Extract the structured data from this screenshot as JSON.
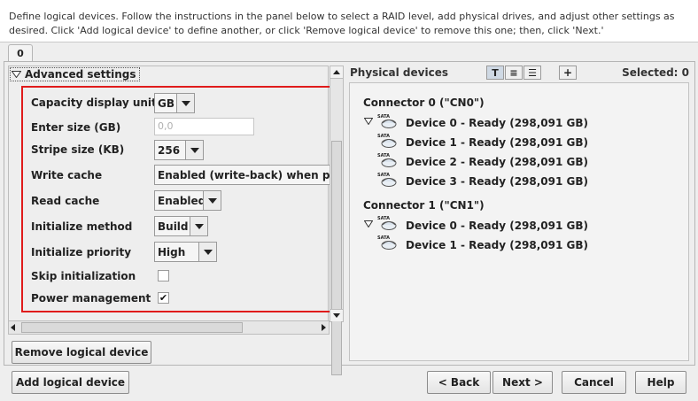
{
  "instructions": "Define logical devices.  Follow the instructions in the panel below to select a RAID level, add physical drives, and adjust other settings as desired.  Click 'Add logical device' to define another, or click 'Remove logical device' to remove this one; then, click 'Next.'",
  "tab": {
    "label": "0"
  },
  "advanced": {
    "header": "Advanced settings",
    "capacity_units": {
      "label": "Capacity display units",
      "value": "GB"
    },
    "enter_size": {
      "label": "Enter size (GB)",
      "placeholder": "0,0"
    },
    "stripe_size": {
      "label": "Stripe size (KB)",
      "value": "256"
    },
    "write_cache": {
      "label": "Write cache",
      "value": "Enabled (write-back) when protect"
    },
    "read_cache": {
      "label": "Read cache",
      "value": "Enabled"
    },
    "init_method": {
      "label": "Initialize method",
      "value": "Build"
    },
    "init_priority": {
      "label": "Initialize priority",
      "value": "High"
    },
    "skip_init": {
      "label": "Skip initialization",
      "checked": false,
      "mark": ""
    },
    "power_mgmt": {
      "label": "Power management",
      "checked": true,
      "mark": "✔"
    }
  },
  "physical": {
    "title": "Physical devices",
    "selected": "Selected: 0",
    "view_buttons": [
      "T",
      "≡",
      "☰"
    ],
    "add_symbol": "+",
    "connectors": [
      {
        "label": "Connector 0 (\"CN0\")",
        "devices": [
          "Device 0 - Ready (298,091 GB)",
          "Device 1 - Ready (298,091 GB)",
          "Device 2 - Ready (298,091 GB)",
          "Device 3 - Ready (298,091 GB)"
        ]
      },
      {
        "label": "Connector 1 (\"CN1\")",
        "devices": [
          "Device 0 - Ready (298,091 GB)",
          "Device 1 - Ready (298,091 GB)"
        ]
      }
    ],
    "disk_badge": "SATA"
  },
  "buttons": {
    "remove": "Remove logical device",
    "add": "Add logical device",
    "back": "< Back",
    "next": "Next >",
    "cancel": "Cancel",
    "help": "Help"
  },
  "colors": {
    "highlight_box": "#e01b1b"
  }
}
